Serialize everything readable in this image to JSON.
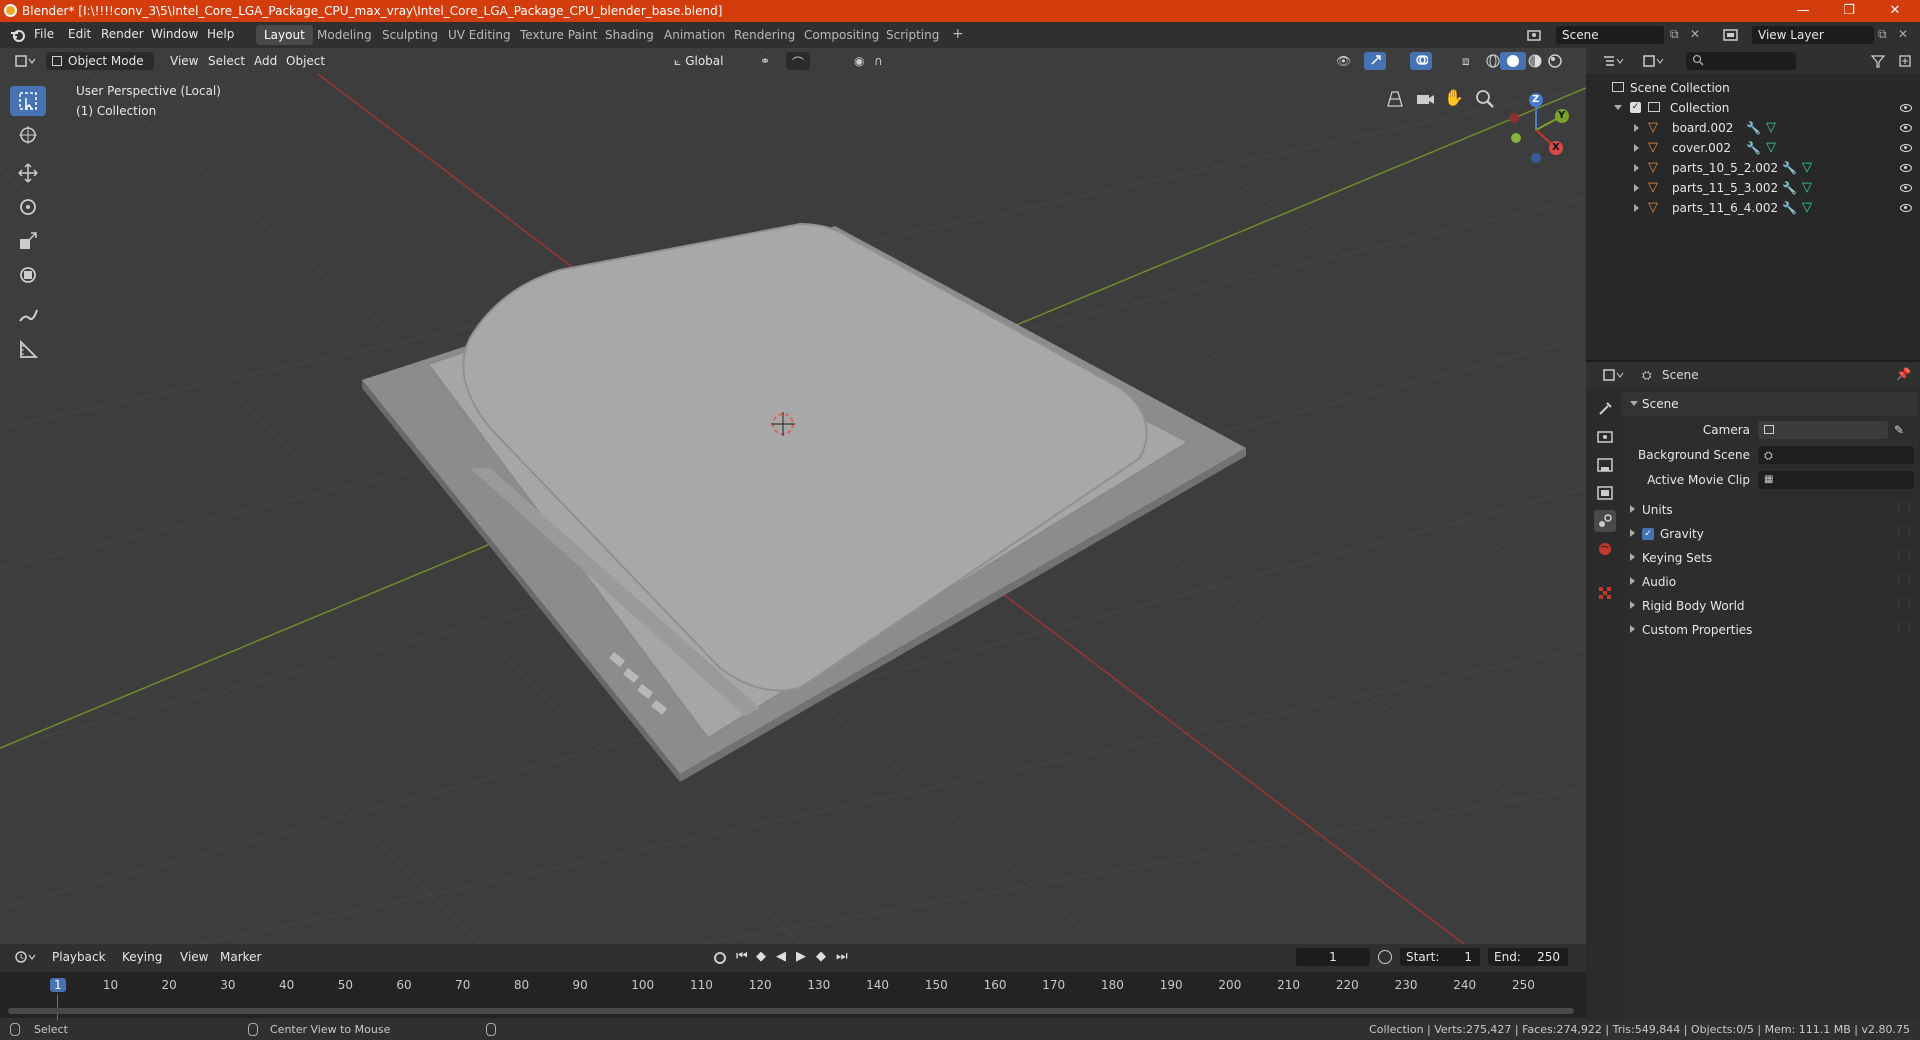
{
  "window": {
    "title": "Blender* [I:\\!!!!conv_3\\5\\Intel_Core_LGA_Package_CPU_max_vray\\Intel_Core_LGA_Package_CPU_blender_base.blend]",
    "minimize": "—",
    "maximize": "❐",
    "close": "✕"
  },
  "menu": {
    "items": [
      "File",
      "Edit",
      "Render",
      "Window",
      "Help"
    ]
  },
  "workspaces": [
    "Layout",
    "Modeling",
    "Sculpting",
    "UV Editing",
    "Texture Paint",
    "Shading",
    "Animation",
    "Rendering",
    "Compositing",
    "Scripting"
  ],
  "workspace_add": "+",
  "scene_selector": {
    "value": "Scene"
  },
  "view_layer": {
    "value": "View Layer"
  },
  "viewport": {
    "mode": "Object Mode",
    "menus": [
      "View",
      "Select",
      "Add",
      "Object"
    ],
    "transform_orientation": "Global",
    "perspective_label": "User Perspective (Local)",
    "collection_label": "(1) Collection",
    "gizmo": {
      "z": "Z",
      "y": "Y",
      "x": "X"
    }
  },
  "outliner": {
    "root": "Scene Collection",
    "collection": "Collection",
    "objects": [
      "board.002",
      "cover.002",
      "parts_10_5_2.002",
      "parts_11_5_3.002",
      "parts_11_6_4.002"
    ]
  },
  "properties": {
    "context_label": "Scene",
    "panel_title": "Scene",
    "fields": [
      {
        "label": "Camera",
        "value": ""
      },
      {
        "label": "Background Scene",
        "value": ""
      },
      {
        "label": "Active Movie Clip",
        "value": ""
      }
    ],
    "subpanels": [
      "Units",
      "Gravity",
      "Keying Sets",
      "Audio",
      "Rigid Body World",
      "Custom Properties"
    ],
    "gravity_checked": true
  },
  "timeline": {
    "menus": [
      "Playback",
      "Keying",
      "View",
      "Marker"
    ],
    "current_frame": "1",
    "start_label": "Start:",
    "start": "1",
    "end_label": "End:",
    "end": "250",
    "ruler": [
      "1",
      "10",
      "20",
      "30",
      "40",
      "50",
      "60",
      "70",
      "80",
      "90",
      "100",
      "110",
      "120",
      "130",
      "140",
      "150",
      "160",
      "170",
      "180",
      "190",
      "200",
      "210",
      "220",
      "230",
      "240",
      "250"
    ]
  },
  "statusbar": {
    "select": "Select",
    "center_view": "Center View to Mouse",
    "stats": "Collection | Verts:275,427 | Faces:274,922 | Tris:549,844 | Objects:0/5 | Mem: 111.1 MB | v2.80.75"
  },
  "colors": {
    "title_bar": "#d33c0c",
    "accent_blue": "#4772b3",
    "axis_red": "#c0392b",
    "axis_green": "#7aa32a",
    "mesh_orange": "#e8893a"
  }
}
